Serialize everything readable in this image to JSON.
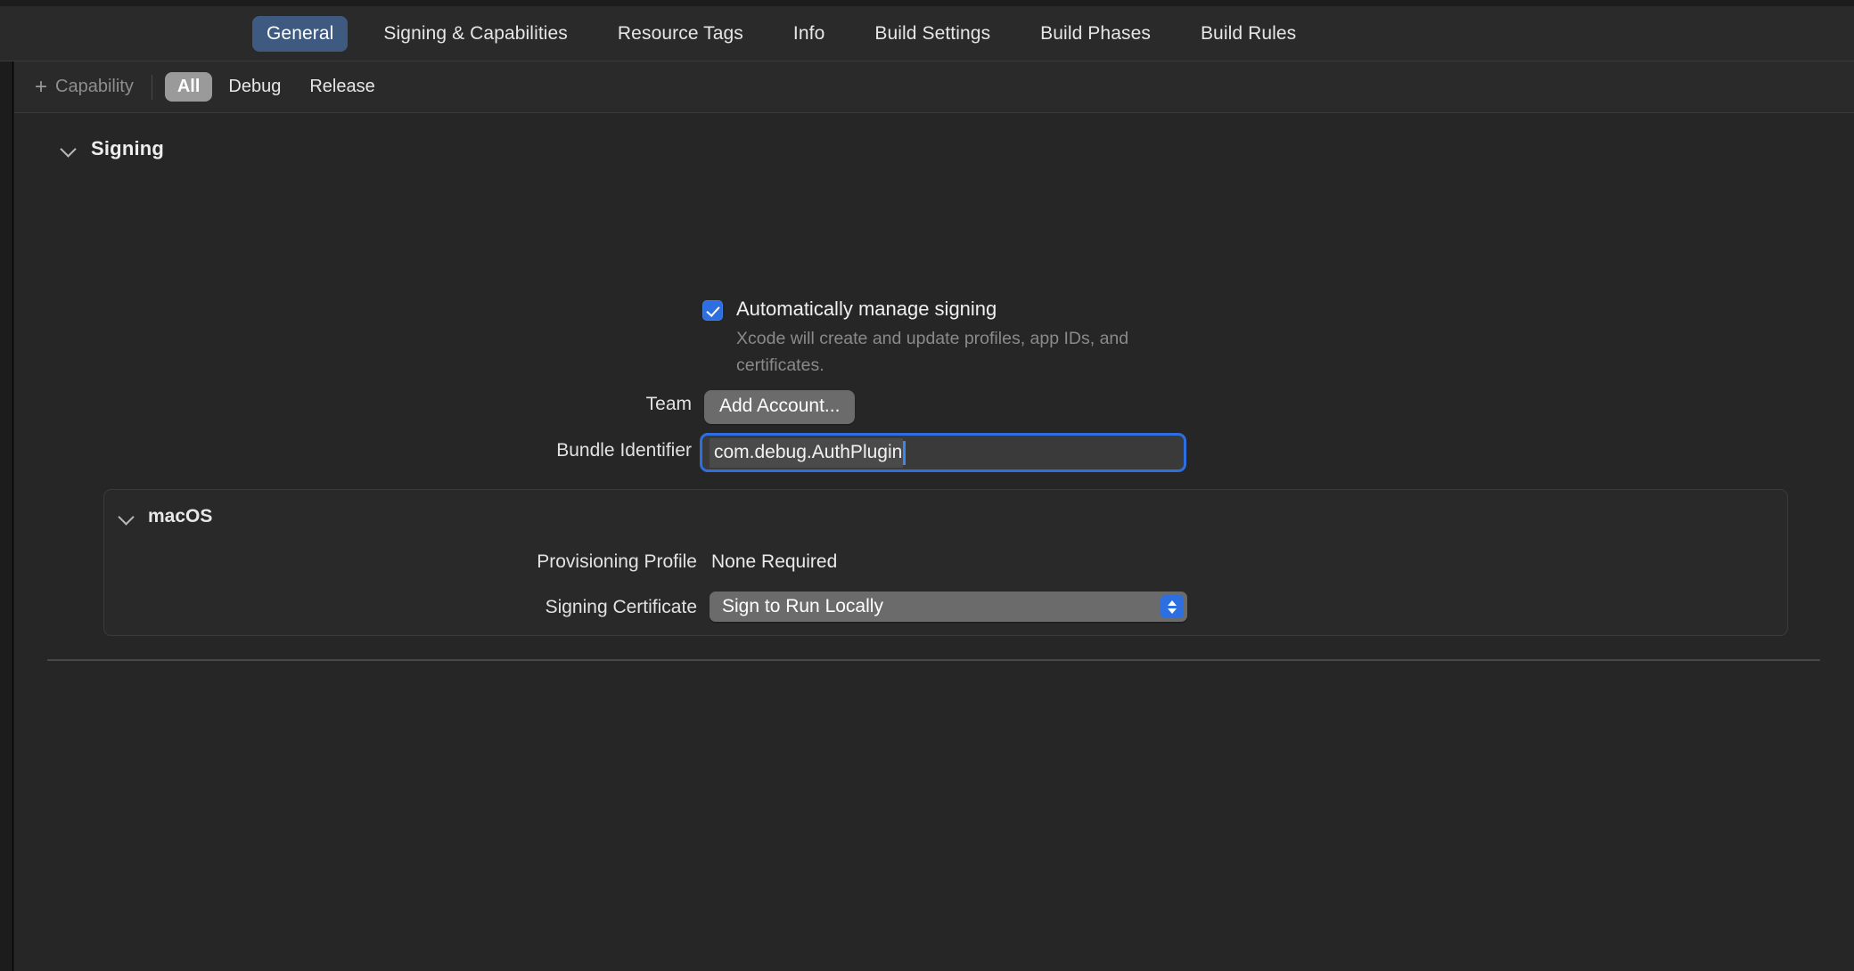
{
  "tabs": [
    {
      "label": "General",
      "active": true
    },
    {
      "label": "Signing & Capabilities",
      "active": false
    },
    {
      "label": "Resource Tags",
      "active": false
    },
    {
      "label": "Info",
      "active": false
    },
    {
      "label": "Build Settings",
      "active": false
    },
    {
      "label": "Build Phases",
      "active": false
    },
    {
      "label": "Build Rules",
      "active": false
    }
  ],
  "capability_bar": {
    "add_label": "Capability",
    "plus_icon": "plus-icon",
    "filters": [
      {
        "label": "All",
        "active": true
      },
      {
        "label": "Debug",
        "active": false
      },
      {
        "label": "Release",
        "active": false
      }
    ]
  },
  "signing": {
    "section_title": "Signing",
    "disclosure_icon": "chevron-down-icon",
    "auto_manage": {
      "checked": true,
      "label": "Automatically manage signing",
      "description": "Xcode will create and update profiles, app IDs, and certificates."
    },
    "team": {
      "label": "Team",
      "button_label": "Add Account..."
    },
    "bundle_identifier": {
      "label": "Bundle Identifier",
      "value": "com.debug.AuthPlugin",
      "focused": true
    },
    "platform": {
      "disclosure_icon": "chevron-down-icon",
      "title": "macOS",
      "provisioning_profile": {
        "label": "Provisioning Profile",
        "value": "None Required"
      },
      "signing_certificate": {
        "label": "Signing Certificate",
        "value": "Sign to Run Locally",
        "stepper_icon": "up-down-chevron-icon"
      }
    }
  },
  "colors": {
    "window_background": "#1e1e1e",
    "content_background": "#262626",
    "tab_active": "#3e5a80",
    "filter_active": "#9a9a9a",
    "accent_blue": "#2d6fe0",
    "button_gray": "#6b6b6b",
    "muted_text": "#8a8a8a"
  }
}
